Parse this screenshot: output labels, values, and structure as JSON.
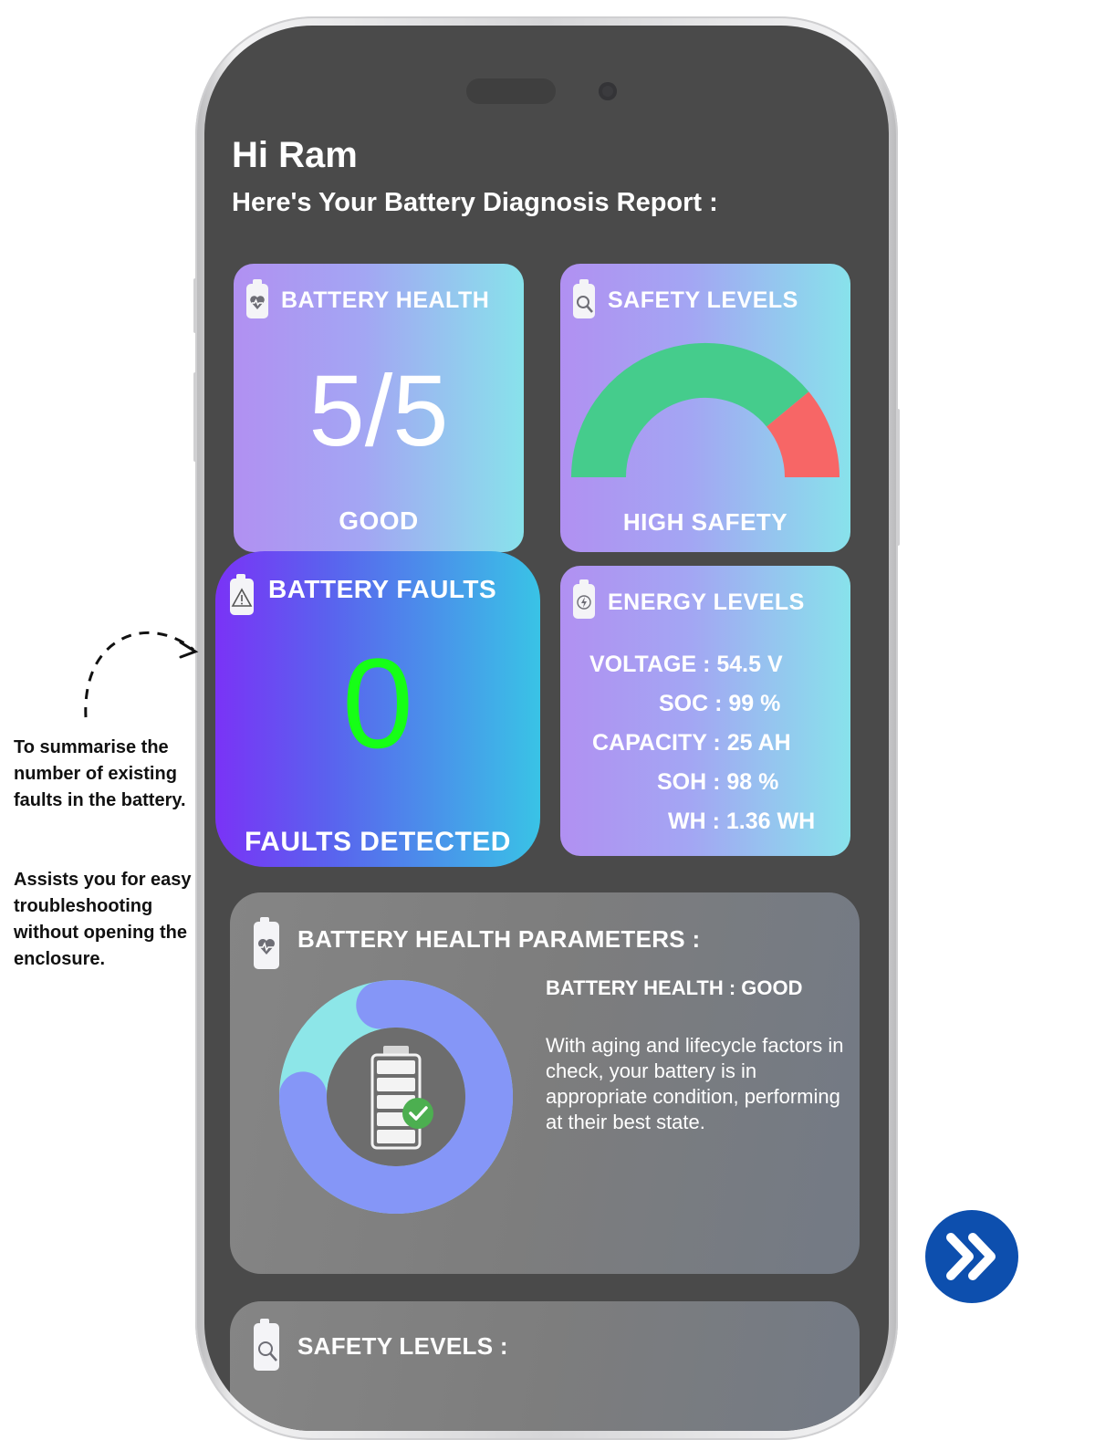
{
  "header": {
    "greeting": "Hi Ram",
    "subtitle": "Here's Your Battery Diagnosis Report :"
  },
  "battery_health_card": {
    "title": "BATTERY HEALTH",
    "score": "5/5",
    "status": "GOOD",
    "icon": "battery-heart-icon"
  },
  "safety_card": {
    "title": "SAFETY LEVELS",
    "status": "HIGH SAFETY",
    "icon": "battery-search-icon",
    "gauge": {
      "safe_fraction": 0.78,
      "danger_fraction": 0.22,
      "safe_color": "#45cc8c",
      "danger_color": "#f76666"
    }
  },
  "faults_card": {
    "title": "BATTERY FAULTS",
    "count": "0",
    "label": "FAULTS DETECTED",
    "icon": "battery-warning-icon",
    "count_color": "#16ff16"
  },
  "energy_card": {
    "title": "ENERGY LEVELS",
    "icon": "battery-bolt-icon",
    "voltage": "VOLTAGE : 54.5 V",
    "soc": "SOC : 99 %",
    "capacity": "CAPACITY : 25 AH",
    "soh": "SOH : 98 %",
    "wh": "WH : 1.36 WH"
  },
  "health_params": {
    "title": "BATTERY HEALTH PARAMETERS :",
    "health_label": "BATTERY HEALTH : GOOD",
    "description": "With aging and lifecycle factors in check, your battery is in appropriate condition, performing at their best state.",
    "icon": "battery-heart-icon",
    "donut": {
      "primary_fraction": 0.78,
      "secondary_fraction": 0.22,
      "primary_color": "#8596f7",
      "secondary_color": "#8de6e8"
    }
  },
  "safety_params": {
    "title": "SAFETY LEVELS :",
    "icon": "battery-search-icon"
  },
  "annotation": {
    "line1": "To summarise the number of existing faults in the battery.",
    "line2": "Assists you for easy troubleshooting without opening the enclosure."
  },
  "next_button": {
    "icon": "double-chevron-right-icon",
    "color": "#0d4fae"
  }
}
